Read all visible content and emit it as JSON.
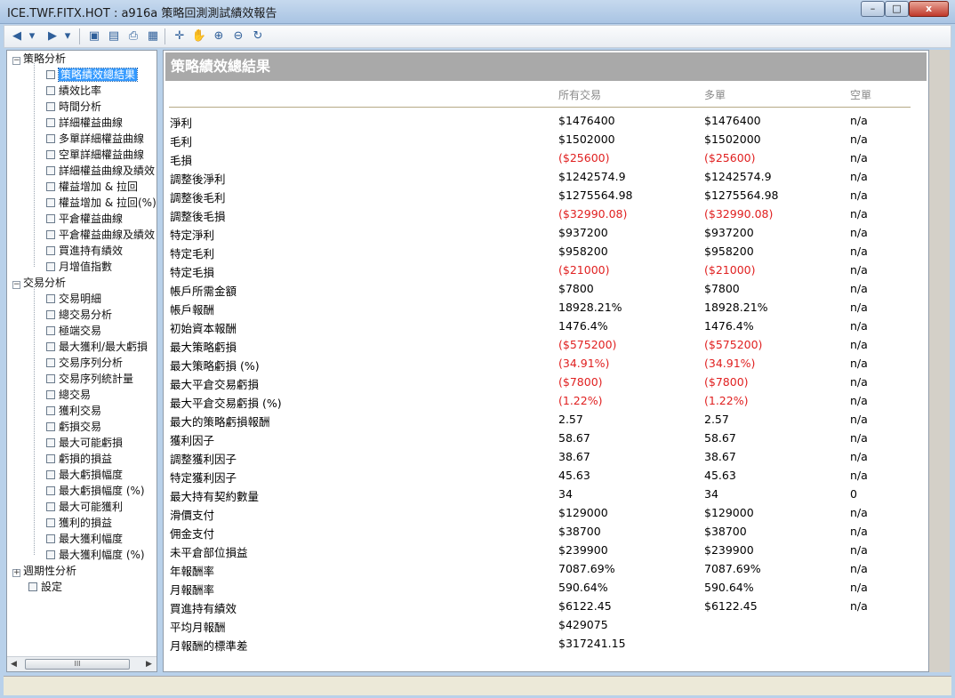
{
  "window": {
    "title": "ICE.TWF.FITX.HOT : a916a 策略回測測試績效報告",
    "min_glyph": "–",
    "max_glyph": "□",
    "close_glyph": "x"
  },
  "toolbar": [
    {
      "name": "back-icon",
      "glyph": "◀"
    },
    {
      "name": "back-dropdown-icon",
      "glyph": "▾"
    },
    {
      "name": "forward-icon",
      "glyph": "▶"
    },
    {
      "name": "forward-dropdown-icon",
      "glyph": "▾"
    },
    {
      "name": "save-icon",
      "glyph": "▣"
    },
    {
      "name": "document-icon",
      "glyph": "▤"
    },
    {
      "name": "print-icon",
      "glyph": "⎙"
    },
    {
      "name": "window-icon",
      "glyph": "▦"
    },
    {
      "name": "crosshair-icon",
      "glyph": "✛"
    },
    {
      "name": "hand-icon",
      "glyph": "✋"
    },
    {
      "name": "zoom-in-icon",
      "glyph": "⊕"
    },
    {
      "name": "zoom-out-icon",
      "glyph": "⊖"
    },
    {
      "name": "refresh-icon",
      "glyph": "↻"
    }
  ],
  "tree": {
    "groups": [
      {
        "label": "策略分析",
        "expander": "−",
        "items": [
          {
            "label": "策略績效總結果",
            "selected": true
          },
          {
            "label": "績效比率"
          },
          {
            "label": "時間分析"
          },
          {
            "label": "詳細權益曲線"
          },
          {
            "label": "多單詳細權益曲線"
          },
          {
            "label": "空單詳細權益曲線"
          },
          {
            "label": "詳細權益曲線及績效"
          },
          {
            "label": "權益增加 & 拉回"
          },
          {
            "label": "權益增加 & 拉回(%)"
          },
          {
            "label": "平倉權益曲線"
          },
          {
            "label": "平倉權益曲線及績效"
          },
          {
            "label": "買進持有績效"
          },
          {
            "label": "月增值指數"
          }
        ]
      },
      {
        "label": "交易分析",
        "expander": "−",
        "items": [
          {
            "label": "交易明細"
          },
          {
            "label": "總交易分析"
          },
          {
            "label": "極端交易"
          },
          {
            "label": "最大獲利/最大虧損"
          },
          {
            "label": "交易序列分析"
          },
          {
            "label": "交易序列統計量"
          },
          {
            "label": "總交易"
          },
          {
            "label": "獲利交易"
          },
          {
            "label": "虧損交易"
          },
          {
            "label": "最大可能虧損"
          },
          {
            "label": "虧損的損益"
          },
          {
            "label": "最大虧損幅度"
          },
          {
            "label": "最大虧損幅度 (%)"
          },
          {
            "label": "最大可能獲利"
          },
          {
            "label": "獲利的損益"
          },
          {
            "label": "最大獲利幅度"
          },
          {
            "label": "最大獲利幅度 (%)"
          }
        ]
      },
      {
        "label": "週期性分析",
        "expander": "+",
        "items": []
      }
    ],
    "settings_label": "設定",
    "scroll_left": "◀",
    "scroll_right": "▶",
    "scroll_grip": "III"
  },
  "report": {
    "title": "策略績效總結果",
    "columns": [
      "所有交易",
      "多單",
      "空單"
    ],
    "rows": [
      {
        "label": "淨利",
        "all": "$1476400",
        "long": "$1476400",
        "short": "n/a"
      },
      {
        "label": "毛利",
        "all": "$1502000",
        "long": "$1502000",
        "short": "n/a"
      },
      {
        "label": "毛損",
        "all": "($25600)",
        "long": "($25600)",
        "short": "n/a",
        "negative": true
      },
      {
        "label": "調整後淨利",
        "all": "$1242574.9",
        "long": "$1242574.9",
        "short": "n/a"
      },
      {
        "label": "調整後毛利",
        "all": "$1275564.98",
        "long": "$1275564.98",
        "short": "n/a"
      },
      {
        "label": "調整後毛損",
        "all": "($32990.08)",
        "long": "($32990.08)",
        "short": "n/a",
        "negative": true
      },
      {
        "label": "特定淨利",
        "all": "$937200",
        "long": "$937200",
        "short": "n/a"
      },
      {
        "label": "特定毛利",
        "all": "$958200",
        "long": "$958200",
        "short": "n/a"
      },
      {
        "label": "特定毛損",
        "all": "($21000)",
        "long": "($21000)",
        "short": "n/a",
        "negative": true
      },
      {
        "label": "帳戶所需金額",
        "all": "$7800",
        "long": "$7800",
        "short": "n/a"
      },
      {
        "label": "帳戶報酬",
        "all": "18928.21%",
        "long": "18928.21%",
        "short": "n/a"
      },
      {
        "label": "初始資本報酬",
        "all": "1476.4%",
        "long": "1476.4%",
        "short": "n/a"
      },
      {
        "label": "最大策略虧損",
        "all": "($575200)",
        "long": "($575200)",
        "short": "n/a",
        "negative": true
      },
      {
        "label": "最大策略虧損 (%)",
        "all": "(34.91%)",
        "long": "(34.91%)",
        "short": "n/a",
        "negative": true
      },
      {
        "label": "最大平倉交易虧損",
        "all": "($7800)",
        "long": "($7800)",
        "short": "n/a",
        "negative": true
      },
      {
        "label": "最大平倉交易虧損 (%)",
        "all": "(1.22%)",
        "long": "(1.22%)",
        "short": "n/a",
        "negative": true
      },
      {
        "label": "最大的策略虧損報酬",
        "all": "2.57",
        "long": "2.57",
        "short": "n/a"
      },
      {
        "label": "獲利因子",
        "all": "58.67",
        "long": "58.67",
        "short": "n/a"
      },
      {
        "label": "調整獲利因子",
        "all": "38.67",
        "long": "38.67",
        "short": "n/a"
      },
      {
        "label": "特定獲利因子",
        "all": "45.63",
        "long": "45.63",
        "short": "n/a"
      },
      {
        "label": "最大持有契約數量",
        "all": "34",
        "long": "34",
        "short": "0"
      },
      {
        "label": "滑價支付",
        "all": "$129000",
        "long": "$129000",
        "short": "n/a"
      },
      {
        "label": "佣金支付",
        "all": "$38700",
        "long": "$38700",
        "short": "n/a"
      },
      {
        "label": "未平倉部位損益",
        "all": "$239900",
        "long": "$239900",
        "short": "n/a"
      },
      {
        "label": "年報酬率",
        "all": "7087.69%",
        "long": "7087.69%",
        "short": "n/a"
      },
      {
        "label": "月報酬率",
        "all": "590.64%",
        "long": "590.64%",
        "short": "n/a"
      },
      {
        "label": "買進持有績效",
        "all": "$6122.45",
        "long": "$6122.45",
        "short": "n/a"
      },
      {
        "label": "平均月報酬",
        "all": "$429075",
        "long": "",
        "short": ""
      },
      {
        "label": "月報酬的標準差",
        "all": "$317241.15",
        "long": "",
        "short": ""
      }
    ]
  }
}
